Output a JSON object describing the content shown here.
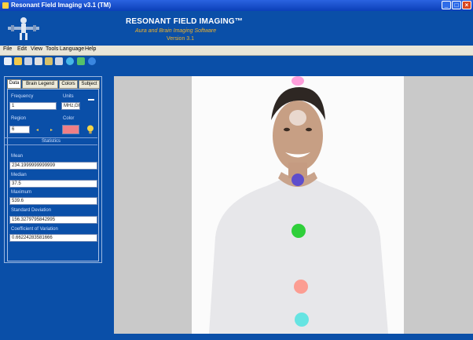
{
  "window": {
    "title": "Resonant Field Imaging v3.1 (TM)"
  },
  "app": {
    "title": "RESONANT FIELD IMAGING™",
    "subtitle": "Aura and Brain Imaging Software",
    "version": "Version 3.1"
  },
  "menu": [
    "File",
    "Edit",
    "View",
    "Tools",
    "Language",
    "Help"
  ],
  "toolbar_icons": [
    "new-icon",
    "open-icon",
    "save-icon",
    "print-icon",
    "settings-icon",
    "camera-icon",
    "globe-icon",
    "refresh-icon",
    "help-icon"
  ],
  "tabs": [
    "Data",
    "Brain Legend",
    "Colors",
    "Subject"
  ],
  "panel": {
    "frequency_label": "Frequency",
    "frequency_value": "1",
    "units_label": "Units",
    "units_value": "MHz,GHz",
    "region_label": "Region",
    "region_value": "6",
    "color_label": "Color",
    "section_label": "Statistics",
    "fields": [
      {
        "label": "Mean",
        "value": "234.1999999999999"
      },
      {
        "label": "Median",
        "value": "37.5"
      },
      {
        "label": "Maximum",
        "value": "539.6"
      },
      {
        "label": "Standard Deviation",
        "value": "156.3279795842995"
      },
      {
        "label": "Coefficient of Variation",
        "value": "0.66224283581666"
      }
    ]
  },
  "colors": {
    "swatch": "#f07f86",
    "chakras": [
      "#ff7fd0",
      "#ffffff",
      "#4b3fd8",
      "#2fcf3a",
      "#ff8f82",
      "#4fe3e0"
    ]
  }
}
